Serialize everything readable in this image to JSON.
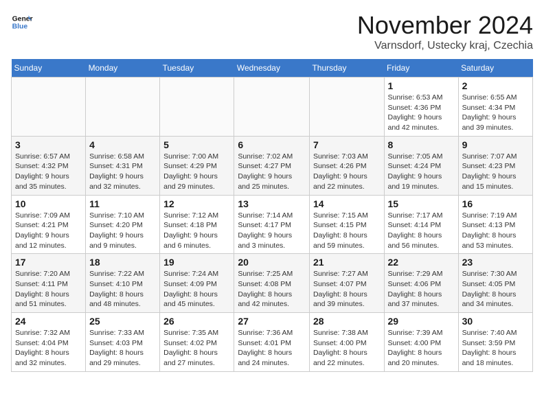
{
  "logo": {
    "line1": "General",
    "line2": "Blue"
  },
  "title": "November 2024",
  "location": "Varnsdorf, Ustecky kraj, Czechia",
  "days_of_week": [
    "Sunday",
    "Monday",
    "Tuesday",
    "Wednesday",
    "Thursday",
    "Friday",
    "Saturday"
  ],
  "weeks": [
    [
      {
        "day": "",
        "info": ""
      },
      {
        "day": "",
        "info": ""
      },
      {
        "day": "",
        "info": ""
      },
      {
        "day": "",
        "info": ""
      },
      {
        "day": "",
        "info": ""
      },
      {
        "day": "1",
        "info": "Sunrise: 6:53 AM\nSunset: 4:36 PM\nDaylight: 9 hours and 42 minutes."
      },
      {
        "day": "2",
        "info": "Sunrise: 6:55 AM\nSunset: 4:34 PM\nDaylight: 9 hours and 39 minutes."
      }
    ],
    [
      {
        "day": "3",
        "info": "Sunrise: 6:57 AM\nSunset: 4:32 PM\nDaylight: 9 hours and 35 minutes."
      },
      {
        "day": "4",
        "info": "Sunrise: 6:58 AM\nSunset: 4:31 PM\nDaylight: 9 hours and 32 minutes."
      },
      {
        "day": "5",
        "info": "Sunrise: 7:00 AM\nSunset: 4:29 PM\nDaylight: 9 hours and 29 minutes."
      },
      {
        "day": "6",
        "info": "Sunrise: 7:02 AM\nSunset: 4:27 PM\nDaylight: 9 hours and 25 minutes."
      },
      {
        "day": "7",
        "info": "Sunrise: 7:03 AM\nSunset: 4:26 PM\nDaylight: 9 hours and 22 minutes."
      },
      {
        "day": "8",
        "info": "Sunrise: 7:05 AM\nSunset: 4:24 PM\nDaylight: 9 hours and 19 minutes."
      },
      {
        "day": "9",
        "info": "Sunrise: 7:07 AM\nSunset: 4:23 PM\nDaylight: 9 hours and 15 minutes."
      }
    ],
    [
      {
        "day": "10",
        "info": "Sunrise: 7:09 AM\nSunset: 4:21 PM\nDaylight: 9 hours and 12 minutes."
      },
      {
        "day": "11",
        "info": "Sunrise: 7:10 AM\nSunset: 4:20 PM\nDaylight: 9 hours and 9 minutes."
      },
      {
        "day": "12",
        "info": "Sunrise: 7:12 AM\nSunset: 4:18 PM\nDaylight: 9 hours and 6 minutes."
      },
      {
        "day": "13",
        "info": "Sunrise: 7:14 AM\nSunset: 4:17 PM\nDaylight: 9 hours and 3 minutes."
      },
      {
        "day": "14",
        "info": "Sunrise: 7:15 AM\nSunset: 4:15 PM\nDaylight: 8 hours and 59 minutes."
      },
      {
        "day": "15",
        "info": "Sunrise: 7:17 AM\nSunset: 4:14 PM\nDaylight: 8 hours and 56 minutes."
      },
      {
        "day": "16",
        "info": "Sunrise: 7:19 AM\nSunset: 4:13 PM\nDaylight: 8 hours and 53 minutes."
      }
    ],
    [
      {
        "day": "17",
        "info": "Sunrise: 7:20 AM\nSunset: 4:11 PM\nDaylight: 8 hours and 51 minutes."
      },
      {
        "day": "18",
        "info": "Sunrise: 7:22 AM\nSunset: 4:10 PM\nDaylight: 8 hours and 48 minutes."
      },
      {
        "day": "19",
        "info": "Sunrise: 7:24 AM\nSunset: 4:09 PM\nDaylight: 8 hours and 45 minutes."
      },
      {
        "day": "20",
        "info": "Sunrise: 7:25 AM\nSunset: 4:08 PM\nDaylight: 8 hours and 42 minutes."
      },
      {
        "day": "21",
        "info": "Sunrise: 7:27 AM\nSunset: 4:07 PM\nDaylight: 8 hours and 39 minutes."
      },
      {
        "day": "22",
        "info": "Sunrise: 7:29 AM\nSunset: 4:06 PM\nDaylight: 8 hours and 37 minutes."
      },
      {
        "day": "23",
        "info": "Sunrise: 7:30 AM\nSunset: 4:05 PM\nDaylight: 8 hours and 34 minutes."
      }
    ],
    [
      {
        "day": "24",
        "info": "Sunrise: 7:32 AM\nSunset: 4:04 PM\nDaylight: 8 hours and 32 minutes."
      },
      {
        "day": "25",
        "info": "Sunrise: 7:33 AM\nSunset: 4:03 PM\nDaylight: 8 hours and 29 minutes."
      },
      {
        "day": "26",
        "info": "Sunrise: 7:35 AM\nSunset: 4:02 PM\nDaylight: 8 hours and 27 minutes."
      },
      {
        "day": "27",
        "info": "Sunrise: 7:36 AM\nSunset: 4:01 PM\nDaylight: 8 hours and 24 minutes."
      },
      {
        "day": "28",
        "info": "Sunrise: 7:38 AM\nSunset: 4:00 PM\nDaylight: 8 hours and 22 minutes."
      },
      {
        "day": "29",
        "info": "Sunrise: 7:39 AM\nSunset: 4:00 PM\nDaylight: 8 hours and 20 minutes."
      },
      {
        "day": "30",
        "info": "Sunrise: 7:40 AM\nSunset: 3:59 PM\nDaylight: 8 hours and 18 minutes."
      }
    ]
  ]
}
